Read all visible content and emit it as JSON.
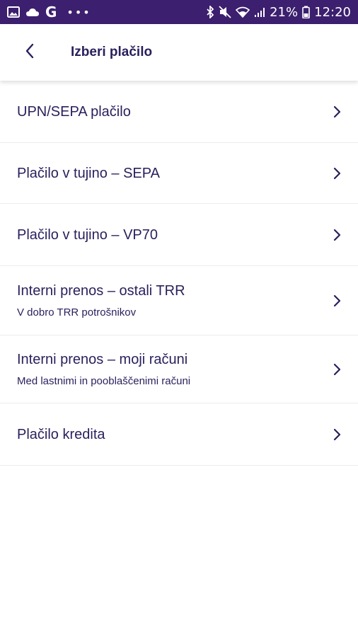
{
  "status_bar": {
    "icons_left": [
      "image-icon",
      "cloud-icon",
      "google-g-icon",
      "more-dots-icon"
    ],
    "google_letter": "G",
    "dots": "•••",
    "icons_right": [
      "bluetooth-icon",
      "mute-icon",
      "wifi-icon",
      "signal-icon"
    ],
    "battery": "21%",
    "time": "12:20"
  },
  "header": {
    "title": "Izberi plačilo",
    "back_icon": "chevron-left-icon"
  },
  "colors": {
    "status_bar": "#3c1f6e",
    "text": "#2a1f5c",
    "divider": "#ececf2"
  },
  "items": [
    {
      "title": "UPN/SEPA plačilo"
    },
    {
      "title": "Plačilo v tujino – SEPA"
    },
    {
      "title": "Plačilo v tujino – VP70"
    },
    {
      "title": "Interni prenos – ostali TRR",
      "subtitle": "V dobro TRR potrošnikov"
    },
    {
      "title": "Interni prenos – moji računi",
      "subtitle": "Med lastnimi in pooblaščenimi računi"
    },
    {
      "title": "Plačilo kredita"
    }
  ]
}
